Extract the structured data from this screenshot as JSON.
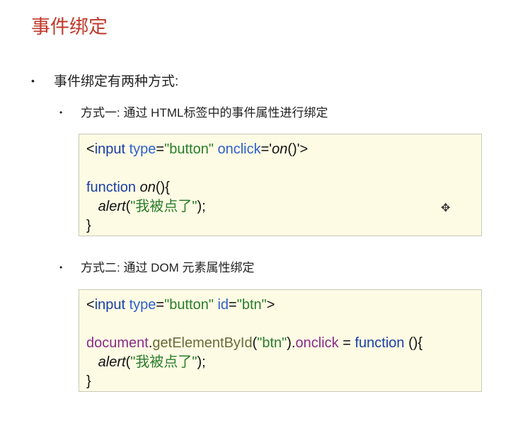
{
  "title": "事件绑定",
  "bullet1": "事件绑定有两种方式:",
  "bullet_dot": "•",
  "method1": "方式一: 通过 HTML标签中的事件属性进行绑定",
  "method2": "方式二: 通过 DOM 元素属性绑定",
  "code_blocks": [
    {
      "lines": [
        [
          {
            "t": "<",
            "c": ""
          },
          {
            "t": "input",
            "c": "tag"
          },
          {
            "t": " type",
            "c": "attr"
          },
          {
            "t": "=",
            "c": ""
          },
          {
            "t": "\"button\"",
            "c": "str"
          },
          {
            "t": " onclick",
            "c": "attr"
          },
          {
            "t": "='",
            "c": ""
          },
          {
            "t": "on",
            "c": "it"
          },
          {
            "t": "()'>",
            "c": ""
          }
        ],
        [],
        [
          {
            "t": "function",
            "c": "kw"
          },
          {
            "t": " ",
            "c": ""
          },
          {
            "t": "on",
            "c": "it"
          },
          {
            "t": "(){",
            "c": ""
          }
        ],
        [
          {
            "t": "   ",
            "c": ""
          },
          {
            "t": "alert",
            "c": "it"
          },
          {
            "t": "(",
            "c": ""
          },
          {
            "t": "\"我被点了\"",
            "c": "str"
          },
          {
            "t": ");",
            "c": ""
          }
        ],
        [
          {
            "t": "}",
            "c": ""
          }
        ]
      ]
    },
    {
      "lines": [
        [
          {
            "t": "<",
            "c": ""
          },
          {
            "t": "input",
            "c": "tag"
          },
          {
            "t": " type",
            "c": "attr"
          },
          {
            "t": "=",
            "c": ""
          },
          {
            "t": "\"button\"",
            "c": "str"
          },
          {
            "t": " id",
            "c": "attr"
          },
          {
            "t": "=",
            "c": ""
          },
          {
            "t": "\"btn\"",
            "c": "str"
          },
          {
            "t": ">",
            "c": ""
          }
        ],
        [],
        [
          {
            "t": "document",
            "c": "obj"
          },
          {
            "t": ".",
            "c": ""
          },
          {
            "t": "getElementById",
            "c": "meth"
          },
          {
            "t": "(",
            "c": ""
          },
          {
            "t": "\"btn\"",
            "c": "str"
          },
          {
            "t": ").",
            "c": ""
          },
          {
            "t": "onclick",
            "c": "prop"
          },
          {
            "t": " = ",
            "c": ""
          },
          {
            "t": "function",
            "c": "kw"
          },
          {
            "t": " (){",
            "c": ""
          }
        ],
        [
          {
            "t": "   ",
            "c": ""
          },
          {
            "t": "alert",
            "c": "it"
          },
          {
            "t": "(",
            "c": ""
          },
          {
            "t": "\"我被点了\"",
            "c": "str"
          },
          {
            "t": ");",
            "c": ""
          }
        ],
        [
          {
            "t": "}",
            "c": ""
          }
        ]
      ]
    }
  ],
  "colors": {
    "title": "#c0392b",
    "code_bg": "#fdfbe4"
  }
}
